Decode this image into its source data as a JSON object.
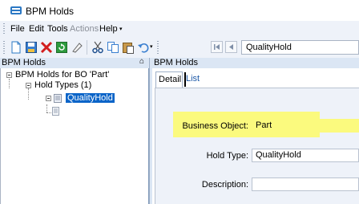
{
  "window": {
    "title": "BPM Holds"
  },
  "menu": {
    "items": [
      "File",
      "Edit",
      "Tools",
      "Actions",
      "Help"
    ]
  },
  "toolbar": {
    "icons": [
      "new-icon",
      "save-icon",
      "delete-icon",
      "refresh-icon",
      "clear-icon",
      "cut-icon",
      "copy-icon",
      "paste-icon",
      "undo-icon",
      "first-record-icon",
      "previous-record-icon"
    ],
    "hold_selector_value": "QualityHold"
  },
  "left_pane": {
    "header": "BPM Holds",
    "pin_glyph": "⌂",
    "tree": {
      "root": "BPM Holds for BO 'Part'",
      "group": "Hold Types (1)",
      "selected": "QualityHold"
    }
  },
  "right_pane": {
    "header": "BPM Holds",
    "tabs": [
      "Detail",
      "List"
    ],
    "fields": {
      "business_object_label": "Business Object:",
      "business_object_value": "Part",
      "hold_type_label": "Hold Type:",
      "hold_type_value": "QualityHold",
      "description_label": "Description:",
      "description_value": ""
    }
  },
  "colors": {
    "highlight": "#fbfa7e",
    "selection": "#0a64c8",
    "panel_header": "#dbe6f4"
  }
}
